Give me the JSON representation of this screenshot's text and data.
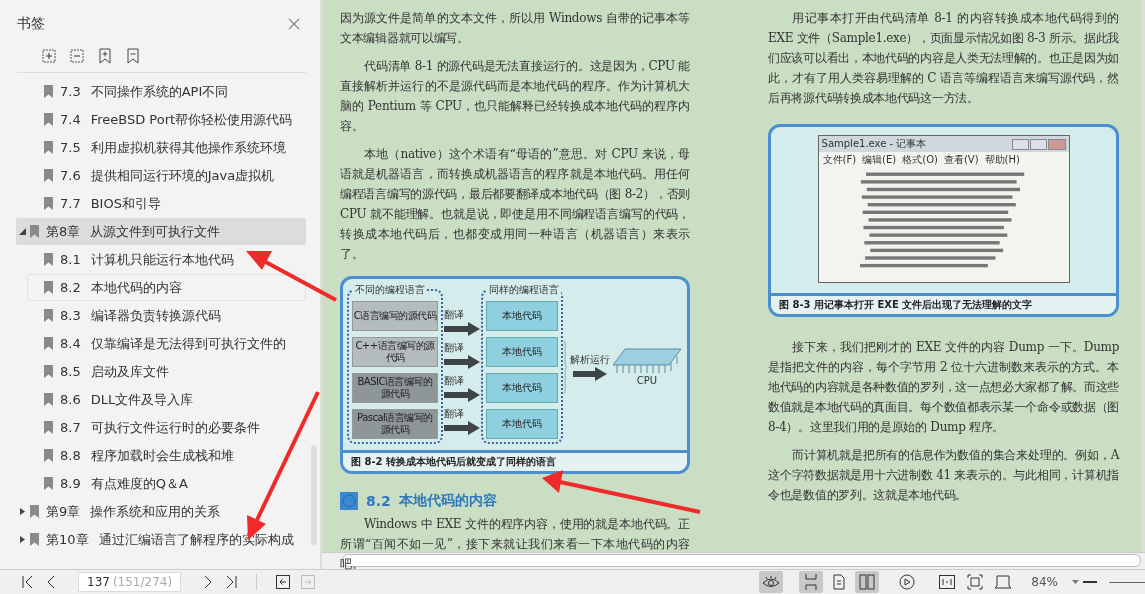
{
  "sidebar": {
    "title": "书签",
    "tree": [
      {
        "children": [
          {
            "number": "7.3",
            "title": "不同操作系统的API不同",
            "selected": false,
            "hovered": false
          },
          {
            "number": "7.4",
            "title": "FreeBSD Port帮你轻松使用源代码",
            "selected": false,
            "hovered": false
          },
          {
            "number": "7.5",
            "title": "利用虚拟机获得其他操作系统环境",
            "selected": false,
            "hovered": false
          },
          {
            "number": "7.6",
            "title": "提供相同运行环境的Java虚拟机",
            "selected": false,
            "hovered": false
          },
          {
            "number": "7.7",
            "title": "BIOS和引导",
            "selected": false,
            "hovered": false
          }
        ]
      },
      {
        "number": "第8章",
        "title": "从源文件到可执行文件",
        "expanded": true,
        "selected": true,
        "hovered": false,
        "children": [
          {
            "number": "8.1",
            "title": "计算机只能运行本地代码",
            "selected": false,
            "hovered": false
          },
          {
            "number": "8.2",
            "title": "本地代码的内容",
            "selected": false,
            "hovered": true
          },
          {
            "number": "8.3",
            "title": "编译器负责转换源代码",
            "selected": false,
            "hovered": false
          },
          {
            "number": "8.4",
            "title": "仅靠编译是无法得到可执行文件的",
            "selected": false,
            "hovered": false
          },
          {
            "number": "8.5",
            "title": "启动及库文件",
            "selected": false,
            "hovered": false
          },
          {
            "number": "8.6",
            "title": "DLL文件及导入库",
            "selected": false,
            "hovered": false
          },
          {
            "number": "8.7",
            "title": "可执行文件运行时的必要条件",
            "selected": false,
            "hovered": false
          },
          {
            "number": "8.8",
            "title": "程序加载时会生成栈和堆",
            "selected": false,
            "hovered": false
          },
          {
            "number": "8.9",
            "title": "有点难度的Q＆A",
            "selected": false,
            "hovered": false
          }
        ]
      },
      {
        "number": "第9章",
        "title": "操作系统和应用的关系",
        "expanded": false,
        "selected": false,
        "hovered": false
      },
      {
        "number": "第10章",
        "title": "通过汇编语言了解程序的实际构成",
        "expanded": false,
        "selected": false,
        "hovered": false
      }
    ]
  },
  "left_page": {
    "paragraphs_top": [
      {
        "indent": false,
        "text": "因为源文件是简单的文本文件，所以用 Windows 自带的记事本等文本编辑器就可以编写。"
      },
      {
        "indent": true,
        "text": "代码清单 8-1 的源代码是无法直接运行的。这是因为，CPU 能直接解析并运行的不是源代码而是本地代码的程序。作为计算机大脑的 Pentium 等 CPU，也只能解释已经转换成本地代码的程序内容。"
      },
      {
        "indent": true,
        "text": "本地（native）这个术语有“母语的”意思。对 CPU 来说，母语就是机器语言，而转换成机器语言的程序就是本地代码。用任何编程语言编写的源代码，最后都要翻译成本地代码（图 8-2），否则 CPU 就不能理解。也就是说，即使是用不同编程语言编写的代码，转换成本地代码后，也都变成用同一种语言（机器语言）来表示了。"
      }
    ],
    "figure": {
      "left_group": "不同的编程语言",
      "right_group": "同样的编程语言",
      "sources": [
        {
          "text": "C语言编写的源代码",
          "color": "#b4bcbd"
        },
        {
          "text": "C++语言编写的源代码",
          "color": "#b4bcbd"
        },
        {
          "text": "BASIC语言编写的源代码",
          "color": "#8e9697"
        },
        {
          "text": "Pascal语言编写的源代码",
          "color": "#8e9697"
        }
      ],
      "arrow_labels": [
        "翻译",
        "翻译",
        "翻译",
        "翻译"
      ],
      "targets": [
        "本地代码",
        "本地代码",
        "本地代码",
        "本地代码"
      ],
      "run_label": "解析运行",
      "cpu_label": "CPU",
      "caption": "图 8-2   转换成本地代码后就变成了同样的语言"
    },
    "heading": {
      "number": "8.2",
      "title": "本地代码的内容"
    },
    "paragraphs_bottom": [
      {
        "indent": true,
        "text": "Windows 中 EXE 文件的程序内容，使用的就是本地代码。正所谓“百闻不如一见”，接下来就让我们来看一下本地代码的内容吧。"
      }
    ]
  },
  "right_page": {
    "paragraphs_top": [
      {
        "indent": true,
        "text": "用记事本打开由代码清单 8-1 的内容转换成本地代码得到的 EXE 文件（Sample1.exe），页面显示情况如图 8-3 所示。据此我们应该可以看出，本地代码的内容是人类无法理解的。也正是因为如此，才有了用人类容易理解的 C 语言等编程语言来编写源代码，然后再将源代码转换成本地代码这一方法。"
      }
    ],
    "figure": {
      "window_title": "Sample1.exe - 记事本",
      "menus": [
        "文件(F)",
        "编辑(E)",
        "格式(O)",
        "查看(V)",
        "帮助(H)"
      ],
      "caption": "图 8-3   用记事本打开 EXE 文件后出现了无法理解的文字"
    },
    "paragraphs_bottom": [
      {
        "indent": true,
        "text": "接下来，我们把刚才的 EXE 文件的内容 Dump 一下。Dump 是指把文件的内容，每个字节用 2 位十六进制数来表示的方式。本地代码的内容就是各种数值的罗列，这一点想必大家都了解。而这些数值就是本地代码的真面目。每个数值都表示某一个命令或数据（图 8-4）。这里我们用的是原始的 Dump 程序。"
      },
      {
        "indent": true,
        "text": "而计算机就是把所有的信息作为数值的集合来处理的。例如，A 这个字符数据就是用十六进制数 41 来表示的。与此相同，计算机指令也是数值的罗列。这就是本地代码。"
      }
    ]
  },
  "status_bar": {
    "page": "137",
    "page_total": "(151/274)",
    "back_disabled": false,
    "forward_disabled": true,
    "view_buttons": [
      {
        "kind": "eye",
        "selected": true
      },
      {
        "kind": "continuous",
        "selected": true
      },
      {
        "kind": "single",
        "selected": false
      },
      {
        "kind": "double",
        "selected": true
      },
      {
        "kind": "play",
        "selected": false
      },
      {
        "kind": "actual",
        "selected": false
      },
      {
        "kind": "fitpage",
        "selected": false
      },
      {
        "kind": "fitwidth",
        "selected": false
      }
    ],
    "zoom": "84%"
  }
}
